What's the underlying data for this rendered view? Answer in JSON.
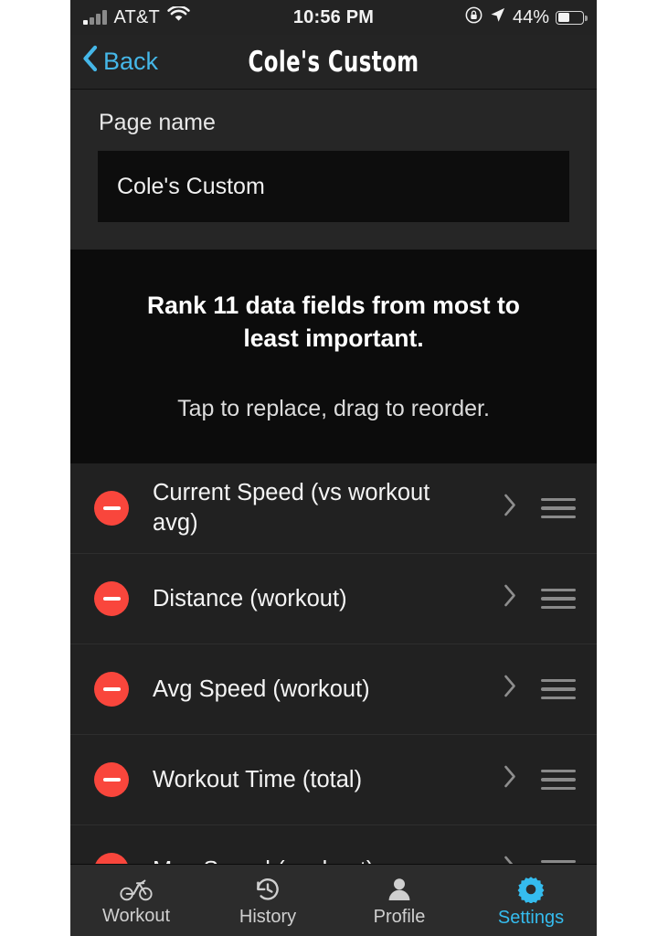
{
  "status_bar": {
    "carrier": "AT&T",
    "wifi_icon": "wifi-icon",
    "signal_icon": "cellular-signal-icon",
    "time": "10:56 PM",
    "rotation_lock_icon": "rotation-lock-icon",
    "location_icon": "location-arrow-icon",
    "battery_percent": "44%",
    "battery_icon": "battery-icon"
  },
  "nav": {
    "back_label": "Back",
    "back_icon": "chevron-left-icon",
    "title": "Cole's Custom"
  },
  "page_name": {
    "label": "Page name",
    "value": "Cole's Custom",
    "placeholder": "Page name"
  },
  "instructions": {
    "heading": "Rank 11 data fields from most to least important.",
    "subtext": "Tap to replace, drag to reorder."
  },
  "fields": [
    {
      "label": "Current Speed (vs workout avg)",
      "remove_icon": "minus-circle-icon",
      "disclosure_icon": "chevron-right-icon",
      "drag_icon": "drag-handle-icon"
    },
    {
      "label": "Distance (workout)",
      "remove_icon": "minus-circle-icon",
      "disclosure_icon": "chevron-right-icon",
      "drag_icon": "drag-handle-icon"
    },
    {
      "label": "Avg Speed (workout)",
      "remove_icon": "minus-circle-icon",
      "disclosure_icon": "chevron-right-icon",
      "drag_icon": "drag-handle-icon"
    },
    {
      "label": "Workout Time (total)",
      "remove_icon": "minus-circle-icon",
      "disclosure_icon": "chevron-right-icon",
      "drag_icon": "drag-handle-icon"
    },
    {
      "label": "Max Speed (workout)",
      "remove_icon": "minus-circle-icon",
      "disclosure_icon": "chevron-right-icon",
      "drag_icon": "drag-handle-icon"
    }
  ],
  "tabs": [
    {
      "label": "Workout",
      "icon": "bicycle-icon",
      "active": false
    },
    {
      "label": "History",
      "icon": "history-clock-icon",
      "active": false
    },
    {
      "label": "Profile",
      "icon": "person-icon",
      "active": false
    },
    {
      "label": "Settings",
      "icon": "gear-icon",
      "active": true
    }
  ],
  "colors": {
    "accent": "#35bcee",
    "back_link": "#45b7e8",
    "destructive": "#f9463c",
    "screen_bg": "#1c1c1c",
    "row_bg": "#212121",
    "instruction_bg": "#0c0c0c"
  }
}
